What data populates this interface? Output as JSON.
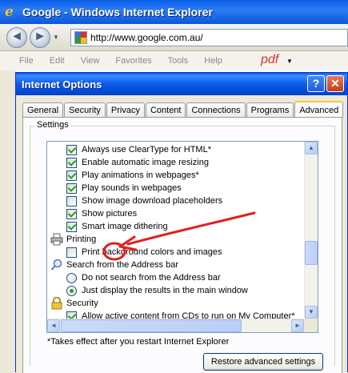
{
  "browser": {
    "title": "Google - Windows Internet Explorer",
    "address": "http://www.google.com.au/",
    "menu": [
      "File",
      "Edit",
      "View",
      "Favorites",
      "Tools",
      "Help"
    ],
    "pdf_label": "pdf"
  },
  "dialog": {
    "title": "Internet Options",
    "help_label": "?",
    "close_label": "✕",
    "tabs": [
      "General",
      "Security",
      "Privacy",
      "Content",
      "Connections",
      "Programs",
      "Advanced"
    ],
    "active_tab": "Advanced",
    "group_label": "Settings",
    "items": [
      {
        "type": "checkbox",
        "checked": true,
        "label": "Always use ClearType for HTML*"
      },
      {
        "type": "checkbox",
        "checked": true,
        "label": "Enable automatic image resizing"
      },
      {
        "type": "checkbox",
        "checked": true,
        "label": "Play animations in webpages*"
      },
      {
        "type": "checkbox",
        "checked": true,
        "label": "Play sounds in webpages"
      },
      {
        "type": "checkbox",
        "checked": false,
        "label": "Show image download placeholders"
      },
      {
        "type": "checkbox",
        "checked": true,
        "label": "Show pictures"
      },
      {
        "type": "checkbox",
        "checked": true,
        "label": "Smart image dithering"
      },
      {
        "type": "category",
        "icon": "printer-icon",
        "label": "Printing"
      },
      {
        "type": "checkbox",
        "checked": false,
        "label": "Print background colors and images"
      },
      {
        "type": "category",
        "icon": "magnifier-icon",
        "label": "Search from the Address bar"
      },
      {
        "type": "radio",
        "checked": false,
        "label": "Do not search from the Address bar"
      },
      {
        "type": "radio",
        "checked": true,
        "label": "Just display the results in the main window"
      },
      {
        "type": "category",
        "icon": "lock-icon",
        "label": "Security"
      },
      {
        "type": "checkbox",
        "checked": true,
        "label": "Allow active content from CDs to run on My Computer*"
      }
    ],
    "footnote": "*Takes effect after you restart Internet Explorer",
    "restore_button": "Restore advanced settings"
  },
  "colors": {
    "annotation": "#e02020",
    "titlebar": "#0a5ce6",
    "check": "#21a121"
  }
}
